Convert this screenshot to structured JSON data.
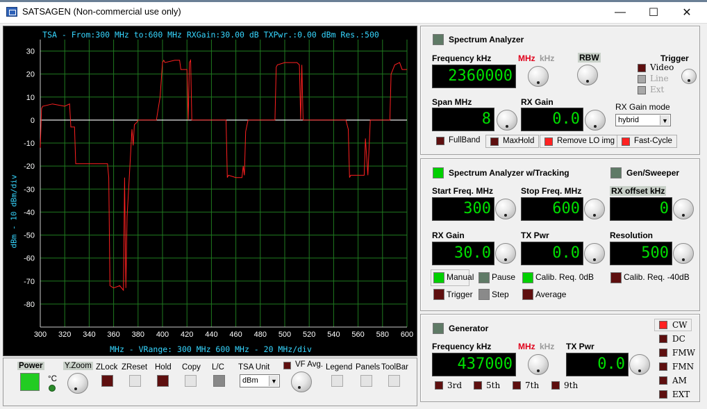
{
  "window": {
    "title": "SATSAGEN (Non-commercial use only)",
    "min_glyph": "—",
    "max_glyph": "☐",
    "close_glyph": "✕"
  },
  "plot": {
    "title": "TSA - From:300 MHz to:600 MHz RXGain:30.00 dB TXPwr.:0.00 dBm Res.:500",
    "footer": "MHz - VRange: 300 MHz 600 MHz - 20 MHz/div",
    "ylabel": "dBm - 10 dBm/div",
    "colors": {
      "background": "#000000",
      "grid": "#1f7a1f",
      "trace": "#ff2020",
      "zero_line": "#ffffff",
      "label": "#36d6ff"
    }
  },
  "chart_data": {
    "type": "line",
    "title": "TSA - From:300 MHz to:600 MHz RXGain:30.00 dB TXPwr.:0.00 dBm Res.:500",
    "xlabel": "MHz - VRange: 300 MHz 600 MHz - 20 MHz/div",
    "ylabel": "dBm - 10 dBm/div",
    "xlim": [
      300,
      600
    ],
    "ylim": [
      -90,
      35
    ],
    "x_ticks": [
      300,
      320,
      340,
      360,
      380,
      400,
      420,
      440,
      460,
      480,
      500,
      520,
      540,
      560,
      580,
      600
    ],
    "y_ticks": [
      30,
      20,
      10,
      0,
      -10,
      -20,
      -30,
      -40,
      -50,
      -60,
      -70,
      -80
    ],
    "grid": true,
    "series": [
      {
        "x": [
          300,
          301,
          302,
          310,
          320,
          324,
          325,
          328,
          329,
          335,
          345,
          350,
          355,
          356,
          357,
          360,
          365,
          368,
          369,
          370,
          371,
          375,
          376,
          377,
          379,
          380,
          386,
          390,
          392,
          395,
          398,
          400,
          401,
          402,
          410,
          414,
          415,
          420,
          421,
          422,
          423,
          424,
          430,
          440,
          450,
          452,
          453,
          454,
          460,
          465,
          466,
          467,
          468,
          470,
          480,
          490,
          492,
          493,
          494,
          500,
          510,
          512,
          513,
          514,
          515,
          520,
          530,
          540,
          550,
          552,
          553,
          554,
          560,
          565,
          566,
          568,
          570,
          575,
          580,
          585,
          586,
          587,
          590,
          594,
          596,
          600
        ],
        "y": [
          -12,
          5,
          6,
          7,
          6,
          7,
          -3,
          -3,
          -19,
          -19,
          -19,
          -19,
          -19,
          -25,
          -72,
          -73,
          -72,
          -74,
          -25,
          -73,
          -42,
          -4,
          -11,
          -2,
          -1,
          0,
          0,
          0,
          0,
          0,
          10,
          25,
          26,
          25,
          26,
          26,
          22,
          22,
          0,
          25,
          26,
          0,
          0,
          0,
          0,
          0,
          -25,
          -24,
          -25,
          -25,
          -20,
          -24,
          -5,
          0,
          0,
          0,
          0,
          23,
          24,
          25,
          25,
          24,
          0,
          24,
          0,
          0,
          0,
          0,
          0,
          -4,
          -25,
          -24,
          -24,
          -24,
          -8,
          -24,
          0,
          0,
          0,
          0,
          0,
          20,
          24,
          25,
          22,
          22
        ]
      }
    ]
  },
  "bottom_controls": {
    "power_label": "Power",
    "yzoom_label": "Y.Zoom",
    "zlock_label": "ZLock",
    "zreset_label": "ZReset",
    "hold_label": "Hold",
    "copy_label": "Copy",
    "lc_label": "L/C",
    "tsa_unit_label": "TSA Unit",
    "tsa_unit_value": "dBm",
    "celsius_label": "°C",
    "vfavg_label": "VF Avg.",
    "legend_label": "Legend",
    "panels_label": "Panels",
    "toolbar_label": "ToolBar"
  },
  "spectrum_analyzer": {
    "title": "Spectrum Analyzer",
    "frequency_label": "Frequency kHz",
    "frequency_value": "2360000",
    "unit_mhz": "MHz",
    "unit_khz": "kHz",
    "rbw_label": "RBW",
    "trigger_label": "Trigger",
    "trigger_options": [
      "Video",
      "Line",
      "Ext"
    ],
    "span_label": "Span MHz",
    "span_value": "8",
    "rx_gain_label": "RX Gain",
    "rx_gain_value": "0.0",
    "rx_gain_mode_label": "RX Gain mode",
    "rx_gain_mode_value": "hybrid",
    "fullband_label": "FullBand",
    "maxhold_label": "MaxHold",
    "remove_lo_label": "Remove LO img",
    "fast_cycle_label": "Fast-Cycle"
  },
  "tracking": {
    "title": "Spectrum Analyzer w/Tracking",
    "gen_title": "Gen/Sweeper",
    "start_label": "Start Freq. MHz",
    "start_value": "300",
    "stop_label": "Stop Freq. MHz",
    "stop_value": "600",
    "rx_offset_label": "RX offset kHz",
    "rx_offset_value": "0",
    "rx_gain_label": "RX Gain",
    "rx_gain_value": "30.0",
    "tx_pwr_label": "TX Pwr",
    "tx_pwr_value": "0.0",
    "resolution_label": "Resolution",
    "resolution_value": "500",
    "manual_label": "Manual",
    "pause_label": "Pause",
    "calib_0_label": "Calib. Req. 0dB",
    "calib_40_label": "Calib. Req. -40dB",
    "trigger_label": "Trigger",
    "step_label": "Step",
    "average_label": "Average"
  },
  "generator": {
    "title": "Generator",
    "frequency_label": "Frequency kHz",
    "frequency_value": "437000",
    "unit_mhz": "MHz",
    "unit_khz": "kHz",
    "tx_pwr_label": "TX Pwr",
    "tx_pwr_value": "0.0",
    "harmonics": [
      "3rd",
      "5th",
      "7th",
      "9th"
    ],
    "modes": [
      "CW",
      "DC",
      "FMW",
      "FMN",
      "AM",
      "EXT"
    ]
  }
}
